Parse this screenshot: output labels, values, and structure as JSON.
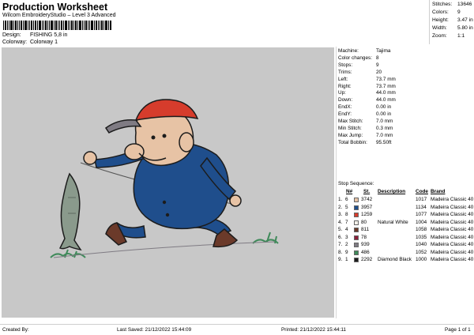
{
  "header": {
    "title": "Production Worksheet",
    "software": "Wilcom EmbroideryStudio – Level 3 Advanced",
    "design_label": "Design:",
    "design_value": "FISHING 5,8 in",
    "colorway_label": "Colorway:",
    "colorway_value": "Colorway 1"
  },
  "stats": {
    "stitches_label": "Stitches:",
    "stitches_value": "13646",
    "colors_label": "Colors:",
    "colors_value": "9",
    "height_label": "Height:",
    "height_value": "3.47 in",
    "width_label": "Width:",
    "width_value": "5.80 in",
    "zoom_label": "Zoom:",
    "zoom_value": "1:1"
  },
  "properties": [
    {
      "label": "Machine:",
      "value": "Tajima"
    },
    {
      "label": "Color changes:",
      "value": "8"
    },
    {
      "label": "Stops:",
      "value": "9"
    },
    {
      "label": "Trims:",
      "value": "20"
    },
    {
      "label": "Left:",
      "value": "73.7 mm"
    },
    {
      "label": "Right:",
      "value": "73.7 mm"
    },
    {
      "label": "Up:",
      "value": "44.0 mm"
    },
    {
      "label": "Down:",
      "value": "44.0 mm"
    },
    {
      "label": "EndX:",
      "value": "0.00 in"
    },
    {
      "label": "EndY:",
      "value": "0.00 in"
    },
    {
      "label": "Max Stitch:",
      "value": "7.0 mm"
    },
    {
      "label": "Min Stitch:",
      "value": "0.3 mm"
    },
    {
      "label": "Max Jump:",
      "value": "7.0 mm"
    },
    {
      "label": "Total Bobbin:",
      "value": "95.50ft"
    }
  ],
  "stop_sequence": {
    "title": "Stop Sequence:",
    "columns": [
      "N#",
      "St.",
      "Description",
      "Code",
      "Brand"
    ],
    "rows": [
      {
        "stop": "1.",
        "n": "6",
        "color": "#e7c3a5",
        "st": "3742",
        "desc": "",
        "code": "1017",
        "brand": "Madeira Classic 40"
      },
      {
        "stop": "2.",
        "n": "5",
        "color": "#1f4e8c",
        "st": "3957",
        "desc": "",
        "code": "1134",
        "brand": "Madeira Classic 40"
      },
      {
        "stop": "3.",
        "n": "8",
        "color": "#d63c2c",
        "st": "1259",
        "desc": "",
        "code": "1077",
        "brand": "Madeira Classic 40"
      },
      {
        "stop": "4.",
        "n": "7",
        "color": "#f4f1ea",
        "st": "80",
        "desc": "Natural White",
        "code": "1004",
        "brand": "Madeira Classic 40"
      },
      {
        "stop": "5.",
        "n": "4",
        "color": "#6b3a2a",
        "st": "811",
        "desc": "",
        "code": "1058",
        "brand": "Madeira Classic 40"
      },
      {
        "stop": "6.",
        "n": "3",
        "color": "#8c1e3a",
        "st": "78",
        "desc": "",
        "code": "1035",
        "brand": "Madeira Classic 40"
      },
      {
        "stop": "7.",
        "n": "2",
        "color": "#7f7b83",
        "st": "939",
        "desc": "",
        "code": "1040",
        "brand": "Madeira Classic 40"
      },
      {
        "stop": "8.",
        "n": "9",
        "color": "#3f8a5a",
        "st": "486",
        "desc": "",
        "code": "1052",
        "brand": "Madeira Classic 40"
      },
      {
        "stop": "9.",
        "n": "1",
        "color": "#1c1c1c",
        "st": "2292",
        "desc": "Diamond Black",
        "code": "1000",
        "brand": "Madeira Classic 40"
      }
    ]
  },
  "footer": {
    "created": "Created By:",
    "saved": "Last Saved: 21/12/2022 15:44:09",
    "printed": "Printed: 21/12/2022 15:44:11",
    "page": "Page 1 of 1"
  }
}
